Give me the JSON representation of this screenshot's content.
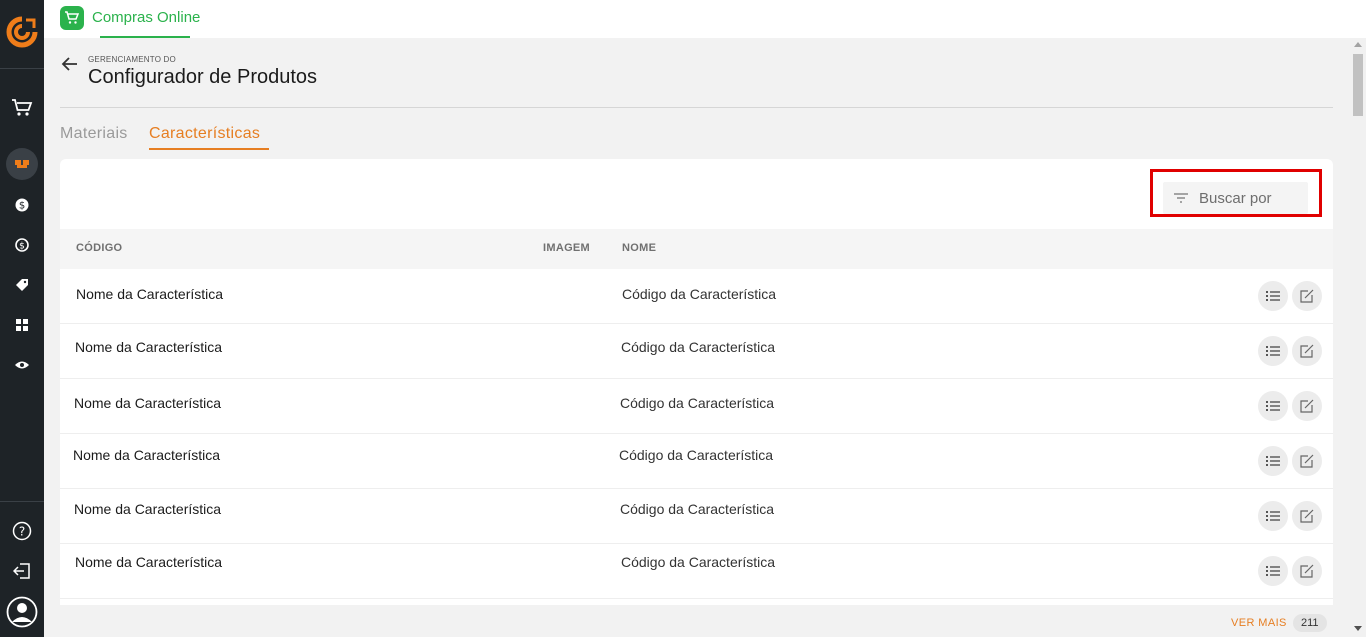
{
  "topbar": {
    "app_name": "Compras Online"
  },
  "page": {
    "overline": "GERENCIAMENTO DO",
    "title": "Configurador de Produtos"
  },
  "tabs": [
    {
      "label": "Materiais",
      "active": false
    },
    {
      "label": "Características",
      "active": true
    }
  ],
  "search": {
    "placeholder": "Buscar por"
  },
  "table": {
    "headers": {
      "col1": "CÓDIGO",
      "col2": "IMAGEM",
      "col3": "NOME"
    },
    "rows": [
      {
        "name": "Nome da Característica",
        "code": "Código da Característica"
      },
      {
        "name": "Nome da Característica",
        "code": "Código da Característica"
      },
      {
        "name": "Nome da Característica",
        "code": "Código da Característica"
      },
      {
        "name": "Nome da Característica",
        "code": "Código da Característica"
      },
      {
        "name": "Nome da Característica",
        "code": "Código da Característica"
      },
      {
        "name": "Nome da Característica",
        "code": "Código da Característica"
      }
    ]
  },
  "footer": {
    "ver_mais": "VER MAIS",
    "count": "211"
  },
  "sidebar": {
    "icons": [
      "cart-icon",
      "custom-icon",
      "dollar-icon",
      "exchange-icon",
      "tag-icon",
      "grid-icon",
      "eye-icon",
      "help-icon",
      "logout-icon",
      "user-icon"
    ]
  },
  "colors": {
    "accent": "#e67e22",
    "brand_green": "#2bb24c",
    "sidebar_bg": "#1e2327",
    "highlight": "#e00000"
  }
}
